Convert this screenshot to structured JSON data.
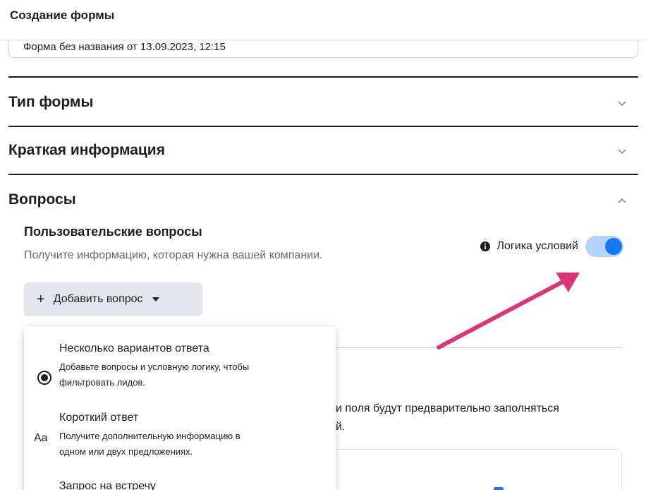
{
  "header": {
    "title": "Создание формы"
  },
  "form_name": {
    "value": "Форма без названия от 13.09.2023, 12:15"
  },
  "sections": [
    {
      "title": "Тип формы",
      "expanded": false
    },
    {
      "title": "Краткая информация",
      "expanded": false
    },
    {
      "title": "Вопросы",
      "expanded": true
    }
  ],
  "questions": {
    "title": "Пользовательские вопросы",
    "description": "Получите информацию, которая нужна вашей компании.",
    "logic_label": "Логика условий",
    "logic_enabled": true,
    "add_button_label": "Добавить вопрос"
  },
  "dropdown": {
    "items": [
      {
        "icon": "radio-icon",
        "title": "Несколько вариантов ответа",
        "description_line1": "Добавьте вопросы и условную логику, чтобы",
        "description_line2": "фильтровать лидов."
      },
      {
        "icon": "text-aa-icon",
        "icon_text": "Aa",
        "title": "Короткий ответ",
        "description_line1": "Получите дополнительную информацию в",
        "description_line2": "одном или двух предложениях."
      },
      {
        "icon": "calendar-icon",
        "title": "Запрос на встречу"
      }
    ]
  },
  "background": {
    "text_line1": "и поля будут предварительно заполняться",
    "text_line2": "й."
  },
  "colors": {
    "accent": "#1877f2",
    "toggle_track": "#b4d3ff",
    "arrow": "#d9367a",
    "button_bg": "#e4e6eb"
  }
}
